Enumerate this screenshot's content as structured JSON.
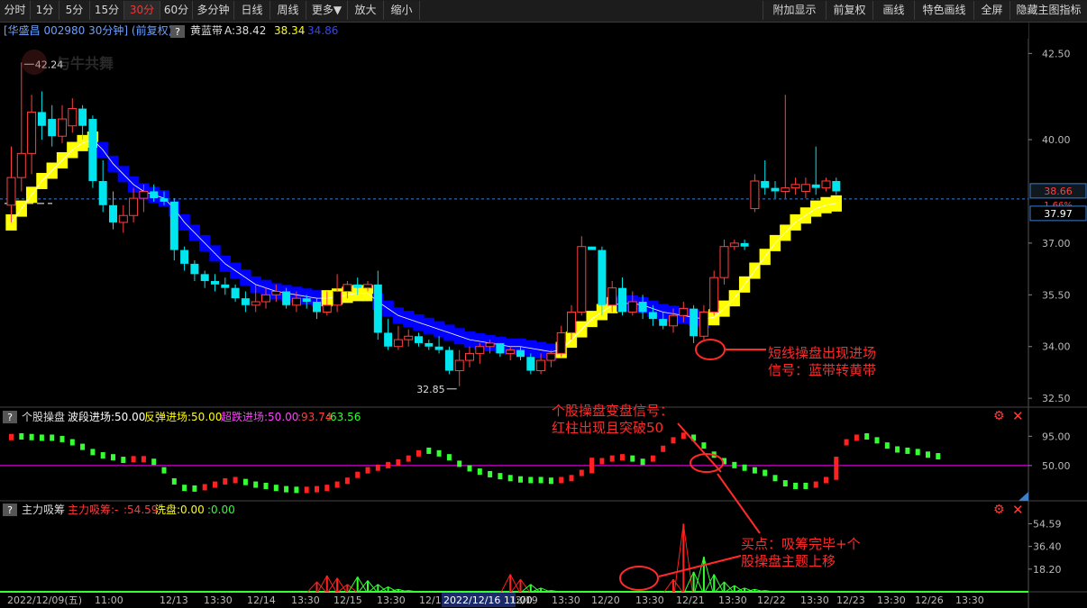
{
  "toolbar": {
    "left": [
      {
        "label": "分时",
        "active": false
      },
      {
        "label": "1分",
        "active": false
      },
      {
        "label": "5分",
        "active": false
      },
      {
        "label": "15分",
        "active": false
      },
      {
        "label": "30分",
        "active": true
      },
      {
        "label": "60分",
        "active": false
      },
      {
        "label": "多分钟",
        "active": false
      },
      {
        "label": "日线",
        "active": false
      },
      {
        "label": "周线",
        "active": false
      },
      {
        "label": "更多▼",
        "active": false
      },
      {
        "label": "放大",
        "active": false
      },
      {
        "label": "缩小",
        "active": false
      }
    ],
    "right": [
      {
        "label": "附加显示"
      },
      {
        "label": "前复权"
      },
      {
        "label": "画线"
      },
      {
        "label": "特色画线"
      },
      {
        "label": "全屏"
      },
      {
        "label": "隐藏主图指标"
      }
    ]
  },
  "main_info": {
    "stock": "[华盛昌 002980 30分钟] (前复权)",
    "q": "?",
    "indicator": "黄蓝带",
    "a_label": "A:38.42",
    "b_value": "38.34",
    "c_value": "34.86",
    "logo": "与牛共舞"
  },
  "price_axis": [
    "42.50",
    "40.00",
    "37.00",
    "35.50",
    "34.00",
    "32.50"
  ],
  "current_price": "38.66",
  "pct_tag": "1.66%",
  "band_price": "37.97",
  "high_note": "42.24",
  "low_note": "32.85",
  "osc1_info": {
    "q": "?",
    "name": "个股操盘",
    "items": [
      {
        "text": "波段进场:50.00",
        "color": "#ffffff"
      },
      {
        "text": "反弹进场:50.00",
        "color": "#ffff00"
      },
      {
        "text": "超跌进场:50.00",
        "color": "#ff44ff"
      },
      {
        "text": ":93.74",
        "color": "#ff3b3b"
      },
      {
        "text": ":63.56",
        "color": "#33ff33"
      }
    ]
  },
  "osc1_axis": [
    "95.00",
    "50.00"
  ],
  "osc2_info": {
    "q": "?",
    "name": "主力吸筹",
    "items": [
      {
        "text": "主力吸筹:-",
        "color": "#ff3b3b"
      },
      {
        "text": ":54.59",
        "color": "#ff3b3b"
      },
      {
        "text": "洗盘:0.00",
        "color": "#ffff00"
      },
      {
        "text": ":0.00",
        "color": "#33ff33"
      }
    ]
  },
  "osc2_axis": [
    "54.59",
    "36.40",
    "18.20"
  ],
  "time_axis": [
    {
      "label": "2022/12/09(五)",
      "hl": false
    },
    {
      "label": "11:00",
      "hl": false
    },
    {
      "label": "12/13",
      "hl": false
    },
    {
      "label": "13:30",
      "hl": false
    },
    {
      "label": "12/14",
      "hl": false
    },
    {
      "label": "13:30",
      "hl": false
    },
    {
      "label": "12/15",
      "hl": false
    },
    {
      "label": "13:30",
      "hl": false
    },
    {
      "label": "12/16",
      "hl": false
    },
    {
      "label": "2022/12/16 11:00",
      "hl": true
    },
    {
      "label": "12/19",
      "hl": false
    },
    {
      "label": "13:30",
      "hl": false
    },
    {
      "label": "12/20",
      "hl": false
    },
    {
      "label": "13:30",
      "hl": false
    },
    {
      "label": "12/21",
      "hl": false
    },
    {
      "label": "13:30",
      "hl": false
    },
    {
      "label": "12/22",
      "hl": false
    },
    {
      "label": "13:30",
      "hl": false
    },
    {
      "label": "12/23",
      "hl": false
    },
    {
      "label": "13:30",
      "hl": false
    },
    {
      "label": "12/26",
      "hl": false
    },
    {
      "label": "13:30",
      "hl": false
    }
  ],
  "annotations": [
    {
      "lines": [
        "短线操盘出现进场",
        "信号：蓝带转黄带"
      ]
    },
    {
      "lines": [
        "个股操盘变盘信号：",
        "红柱出现且突破50"
      ]
    },
    {
      "lines": [
        "买点：吸筹完毕+个",
        "股操盘主题上移"
      ]
    }
  ],
  "colors": {
    "up": "#ff4040",
    "down": "#00e5ee",
    "yellow_band": "#ffff00",
    "blue_band": "#0000ff",
    "osc_green": "#33ff33",
    "osc_red": "#ff2020",
    "mid_line": "#ff00ff",
    "annotation": "#ff2a2a"
  },
  "candles": [
    [
      38.1,
      39.8,
      37.6,
      38.9
    ],
    [
      38.9,
      42.24,
      38.5,
      39.6
    ],
    [
      39.6,
      41.3,
      39.0,
      40.8
    ],
    [
      40.8,
      41.4,
      40.0,
      40.4
    ],
    [
      40.6,
      41.0,
      39.8,
      40.1
    ],
    [
      40.1,
      41.0,
      39.9,
      40.6
    ],
    [
      40.4,
      41.2,
      40.2,
      40.9
    ],
    [
      40.9,
      41.0,
      40.0,
      40.4
    ],
    [
      40.6,
      40.7,
      38.6,
      38.8
    ],
    [
      38.8,
      39.4,
      37.9,
      38.1
    ],
    [
      38.1,
      38.5,
      37.4,
      37.6
    ],
    [
      37.6,
      38.1,
      37.3,
      37.8
    ],
    [
      37.8,
      38.6,
      37.6,
      38.3
    ],
    [
      38.3,
      38.7,
      37.9,
      38.5
    ],
    [
      38.5,
      38.7,
      38.2,
      38.3
    ],
    [
      38.3,
      38.5,
      38.1,
      38.2
    ],
    [
      38.2,
      38.3,
      36.5,
      36.8
    ],
    [
      36.8,
      36.9,
      36.2,
      36.4
    ],
    [
      36.4,
      36.5,
      35.9,
      36.1
    ],
    [
      36.1,
      36.2,
      35.7,
      35.9
    ],
    [
      35.9,
      36.1,
      35.6,
      35.8
    ],
    [
      35.8,
      36.0,
      35.5,
      35.7
    ],
    [
      35.7,
      35.8,
      35.3,
      35.4
    ],
    [
      35.4,
      35.6,
      35.0,
      35.2
    ],
    [
      35.2,
      35.8,
      35.0,
      35.3
    ],
    [
      35.3,
      35.7,
      35.1,
      35.5
    ],
    [
      35.5,
      35.8,
      35.3,
      35.6
    ],
    [
      35.6,
      35.7,
      35.1,
      35.2
    ],
    [
      35.2,
      35.6,
      35.0,
      35.4
    ],
    [
      35.4,
      35.5,
      35.1,
      35.3
    ],
    [
      35.3,
      35.4,
      34.8,
      35.0
    ],
    [
      35.0,
      35.6,
      34.9,
      35.2
    ],
    [
      35.2,
      36.1,
      35.0,
      35.6
    ],
    [
      35.6,
      35.9,
      35.4,
      35.8
    ],
    [
      35.8,
      36.0,
      35.5,
      35.7
    ],
    [
      35.7,
      35.9,
      35.6,
      35.8
    ],
    [
      35.8,
      36.2,
      34.2,
      34.4
    ],
    [
      34.4,
      34.8,
      33.9,
      34.0
    ],
    [
      34.0,
      34.6,
      33.9,
      34.2
    ],
    [
      34.2,
      34.5,
      34.0,
      34.3
    ],
    [
      34.3,
      34.4,
      34.0,
      34.1
    ],
    [
      34.1,
      34.2,
      33.9,
      34.0
    ],
    [
      34.0,
      34.3,
      33.8,
      33.9
    ],
    [
      33.9,
      34.0,
      33.2,
      33.3
    ],
    [
      33.3,
      33.9,
      32.85,
      33.6
    ],
    [
      33.6,
      34.0,
      33.4,
      33.8
    ],
    [
      33.8,
      34.1,
      33.5,
      34.0
    ],
    [
      34.0,
      34.2,
      33.8,
      34.1
    ],
    [
      34.1,
      34.1,
      33.7,
      33.8
    ],
    [
      33.8,
      34.0,
      33.6,
      33.9
    ],
    [
      33.9,
      34.0,
      33.6,
      33.7
    ],
    [
      33.7,
      33.8,
      33.2,
      33.3
    ],
    [
      33.3,
      33.8,
      33.2,
      33.6
    ],
    [
      33.6,
      33.9,
      33.4,
      33.8
    ],
    [
      33.8,
      34.6,
      33.7,
      34.4
    ],
    [
      34.4,
      35.2,
      34.2,
      35.0
    ],
    [
      35.0,
      37.2,
      34.9,
      36.9
    ],
    [
      36.9,
      36.9,
      36.8,
      36.8
    ],
    [
      36.8,
      36.9,
      34.9,
      35.2
    ],
    [
      35.2,
      35.9,
      35.0,
      35.7
    ],
    [
      35.7,
      36.0,
      34.9,
      35.0
    ],
    [
      35.0,
      35.6,
      34.9,
      35.3
    ],
    [
      35.3,
      35.5,
      34.8,
      35.0
    ],
    [
      35.0,
      35.2,
      34.6,
      34.8
    ],
    [
      34.8,
      35.0,
      34.5,
      34.6
    ],
    [
      34.6,
      35.1,
      34.4,
      34.9
    ],
    [
      34.9,
      35.3,
      34.7,
      35.1
    ],
    [
      35.1,
      35.2,
      34.1,
      34.3
    ],
    [
      34.3,
      35.2,
      34.2,
      35.0
    ],
    [
      35.0,
      36.2,
      34.9,
      36.0
    ],
    [
      36.0,
      37.1,
      35.8,
      36.9
    ],
    [
      36.9,
      37.1,
      36.8,
      37.0
    ],
    [
      37.0,
      37.1,
      36.8,
      36.9
    ],
    [
      38.0,
      39.0,
      37.9,
      38.8
    ],
    [
      38.8,
      39.4,
      38.4,
      38.6
    ],
    [
      38.6,
      38.8,
      38.3,
      38.5
    ],
    [
      38.5,
      41.3,
      38.3,
      38.6
    ],
    [
      38.6,
      38.9,
      38.4,
      38.7
    ],
    [
      38.5,
      38.9,
      38.3,
      38.7
    ],
    [
      38.7,
      39.8,
      38.4,
      38.6
    ],
    [
      38.6,
      38.9,
      38.5,
      38.8
    ],
    [
      38.8,
      38.9,
      38.4,
      38.5
    ]
  ],
  "band": [
    [
      37.6,
      "y"
    ],
    [
      38.0,
      "y"
    ],
    [
      38.4,
      "y"
    ],
    [
      38.8,
      "y"
    ],
    [
      39.1,
      "y"
    ],
    [
      39.4,
      "y"
    ],
    [
      39.7,
      "y"
    ],
    [
      39.9,
      "y"
    ],
    [
      40.0,
      "y"
    ],
    [
      39.7,
      "b"
    ],
    [
      39.3,
      "b"
    ],
    [
      39.0,
      "b"
    ],
    [
      38.7,
      "b"
    ],
    [
      38.5,
      "b"
    ],
    [
      38.4,
      "b"
    ],
    [
      38.3,
      "b"
    ],
    [
      38.0,
      "b"
    ],
    [
      37.6,
      "b"
    ],
    [
      37.3,
      "b"
    ],
    [
      37.0,
      "b"
    ],
    [
      36.7,
      "b"
    ],
    [
      36.4,
      "b"
    ],
    [
      36.2,
      "b"
    ],
    [
      36.0,
      "b"
    ],
    [
      35.8,
      "b"
    ],
    [
      35.7,
      "b"
    ],
    [
      35.6,
      "b"
    ],
    [
      35.55,
      "b"
    ],
    [
      35.5,
      "b"
    ],
    [
      35.45,
      "b"
    ],
    [
      35.4,
      "b"
    ],
    [
      35.4,
      "y"
    ],
    [
      35.45,
      "y"
    ],
    [
      35.5,
      "y"
    ],
    [
      35.55,
      "y"
    ],
    [
      35.55,
      "y"
    ],
    [
      35.3,
      "b"
    ],
    [
      35.1,
      "b"
    ],
    [
      34.9,
      "b"
    ],
    [
      34.8,
      "b"
    ],
    [
      34.7,
      "b"
    ],
    [
      34.6,
      "b"
    ],
    [
      34.5,
      "b"
    ],
    [
      34.4,
      "b"
    ],
    [
      34.3,
      "b"
    ],
    [
      34.2,
      "b"
    ],
    [
      34.15,
      "b"
    ],
    [
      34.1,
      "b"
    ],
    [
      34.05,
      "b"
    ],
    [
      34.0,
      "b"
    ],
    [
      34.0,
      "b"
    ],
    [
      33.95,
      "b"
    ],
    [
      33.9,
      "b"
    ],
    [
      33.85,
      "b"
    ],
    [
      33.9,
      "y"
    ],
    [
      34.2,
      "y"
    ],
    [
      34.5,
      "y"
    ],
    [
      34.8,
      "y"
    ],
    [
      35.0,
      "y"
    ],
    [
      35.2,
      "y"
    ],
    [
      35.25,
      "b"
    ],
    [
      35.25,
      "b"
    ],
    [
      35.2,
      "b"
    ],
    [
      35.1,
      "b"
    ],
    [
      35.0,
      "b"
    ],
    [
      34.95,
      "b"
    ],
    [
      34.9,
      "b"
    ],
    [
      34.85,
      "b"
    ],
    [
      34.8,
      "b"
    ],
    [
      34.85,
      "y"
    ],
    [
      35.1,
      "y"
    ],
    [
      35.4,
      "y"
    ],
    [
      35.8,
      "y"
    ],
    [
      36.2,
      "y"
    ],
    [
      36.6,
      "y"
    ],
    [
      37.0,
      "y"
    ],
    [
      37.3,
      "y"
    ],
    [
      37.6,
      "y"
    ],
    [
      37.8,
      "y"
    ],
    [
      38.0,
      "y"
    ],
    [
      38.1,
      "y"
    ],
    [
      38.15,
      "y"
    ]
  ],
  "osc1": [
    [
      93,
      "r"
    ],
    [
      94,
      "g"
    ],
    [
      93,
      "g"
    ],
    [
      92,
      "g"
    ],
    [
      92,
      "g"
    ],
    [
      90,
      "g"
    ],
    [
      85,
      "g"
    ],
    [
      78,
      "g"
    ],
    [
      70,
      "g"
    ],
    [
      65,
      "g"
    ],
    [
      62,
      "g"
    ],
    [
      58,
      "g"
    ],
    [
      59,
      "r"
    ],
    [
      59,
      "r"
    ],
    [
      55,
      "g"
    ],
    [
      42,
      "g"
    ],
    [
      25,
      "g"
    ],
    [
      15,
      "g"
    ],
    [
      14,
      "g"
    ],
    [
      16,
      "r"
    ],
    [
      20,
      "r"
    ],
    [
      25,
      "r"
    ],
    [
      27,
      "r"
    ],
    [
      24,
      "g"
    ],
    [
      20,
      "g"
    ],
    [
      18,
      "g"
    ],
    [
      15,
      "g"
    ],
    [
      13,
      "g"
    ],
    [
      12,
      "g"
    ],
    [
      12,
      "r"
    ],
    [
      13,
      "r"
    ],
    [
      15,
      "r"
    ],
    [
      20,
      "r"
    ],
    [
      26,
      "r"
    ],
    [
      35,
      "r"
    ],
    [
      42,
      "r"
    ],
    [
      46,
      "r"
    ],
    [
      50,
      "r"
    ],
    [
      54,
      "r"
    ],
    [
      60,
      "r"
    ],
    [
      68,
      "r"
    ],
    [
      72,
      "g"
    ],
    [
      68,
      "g"
    ],
    [
      62,
      "g"
    ],
    [
      52,
      "g"
    ],
    [
      45,
      "g"
    ],
    [
      40,
      "g"
    ],
    [
      36,
      "g"
    ],
    [
      33,
      "g"
    ],
    [
      30,
      "g"
    ],
    [
      28,
      "g"
    ],
    [
      27,
      "g"
    ],
    [
      27,
      "g"
    ],
    [
      26,
      "g"
    ],
    [
      27,
      "r"
    ],
    [
      30,
      "r"
    ],
    [
      38,
      "r"
    ],
    [
      50,
      "r"
    ],
    [
      56,
      "r"
    ],
    [
      60,
      "r"
    ],
    [
      62,
      "r"
    ],
    [
      60,
      "g"
    ],
    [
      55,
      "g"
    ],
    [
      60,
      "r"
    ],
    [
      75,
      "r"
    ],
    [
      88,
      "r"
    ],
    [
      95,
      "r"
    ],
    [
      92,
      "g"
    ],
    [
      80,
      "g"
    ],
    [
      66,
      "g"
    ],
    [
      56,
      "g"
    ],
    [
      50,
      "g"
    ],
    [
      46,
      "g"
    ],
    [
      42,
      "g"
    ],
    [
      38,
      "g"
    ],
    [
      30,
      "g"
    ],
    [
      22,
      "g"
    ],
    [
      18,
      "g"
    ],
    [
      18,
      "g"
    ],
    [
      20,
      "r"
    ],
    [
      27,
      "r"
    ],
    [
      58,
      "r"
    ],
    [
      85,
      "r"
    ],
    [
      92,
      "r"
    ],
    [
      94,
      "g"
    ],
    [
      88,
      "g"
    ],
    [
      80,
      "g"
    ],
    [
      74,
      "g"
    ],
    [
      72,
      "g"
    ],
    [
      70,
      "g"
    ],
    [
      66,
      "g"
    ],
    [
      63.56,
      "g"
    ]
  ],
  "osc2": [
    [
      0,
      "g"
    ],
    [
      0,
      "g"
    ],
    [
      0,
      "g"
    ],
    [
      0,
      "g"
    ],
    [
      0,
      "g"
    ],
    [
      0,
      "g"
    ],
    [
      0,
      "g"
    ],
    [
      0,
      "g"
    ],
    [
      0,
      "g"
    ],
    [
      0,
      "g"
    ],
    [
      0,
      "g"
    ],
    [
      0,
      "g"
    ],
    [
      0,
      "g"
    ],
    [
      0,
      "g"
    ],
    [
      0,
      "g"
    ],
    [
      0,
      "g"
    ],
    [
      0,
      "g"
    ],
    [
      0,
      "g"
    ],
    [
      0,
      "g"
    ],
    [
      0,
      "g"
    ],
    [
      0,
      "g"
    ],
    [
      0,
      "g"
    ],
    [
      0,
      "g"
    ],
    [
      0,
      "g"
    ],
    [
      0,
      "g"
    ],
    [
      0,
      "g"
    ],
    [
      0,
      "g"
    ],
    [
      0,
      "g"
    ],
    [
      0,
      "g"
    ],
    [
      0,
      "g"
    ],
    [
      8,
      "r"
    ],
    [
      13,
      "r"
    ],
    [
      11,
      "r"
    ],
    [
      6,
      "r"
    ],
    [
      12,
      "g"
    ],
    [
      9,
      "g"
    ],
    [
      6,
      "g"
    ],
    [
      4,
      "g"
    ],
    [
      2,
      "g"
    ],
    [
      1,
      "g"
    ],
    [
      0,
      "g"
    ],
    [
      0,
      "g"
    ],
    [
      0,
      "g"
    ],
    [
      0,
      "g"
    ],
    [
      0,
      "g"
    ],
    [
      0,
      "g"
    ],
    [
      0,
      "g"
    ],
    [
      0,
      "g"
    ],
    [
      0,
      "g"
    ],
    [
      14,
      "r"
    ],
    [
      10,
      "r"
    ],
    [
      6,
      "g"
    ],
    [
      3,
      "g"
    ],
    [
      1,
      "g"
    ],
    [
      0,
      "g"
    ],
    [
      0,
      "g"
    ],
    [
      0,
      "g"
    ],
    [
      0,
      "g"
    ],
    [
      0,
      "g"
    ],
    [
      0,
      "g"
    ],
    [
      0,
      "g"
    ],
    [
      0,
      "g"
    ],
    [
      0,
      "g"
    ],
    [
      0,
      "g"
    ],
    [
      0,
      "g"
    ],
    [
      10,
      "r"
    ],
    [
      54.59,
      "r"
    ],
    [
      16,
      "g"
    ],
    [
      28,
      "g"
    ],
    [
      14,
      "g"
    ],
    [
      8,
      "g"
    ],
    [
      5,
      "g"
    ],
    [
      3,
      "g"
    ],
    [
      2,
      "g"
    ],
    [
      1,
      "g"
    ],
    [
      0,
      "g"
    ],
    [
      0,
      "g"
    ],
    [
      0,
      "g"
    ],
    [
      0,
      "g"
    ],
    [
      0,
      "g"
    ],
    [
      0,
      "g"
    ],
    [
      0,
      "g"
    ]
  ]
}
